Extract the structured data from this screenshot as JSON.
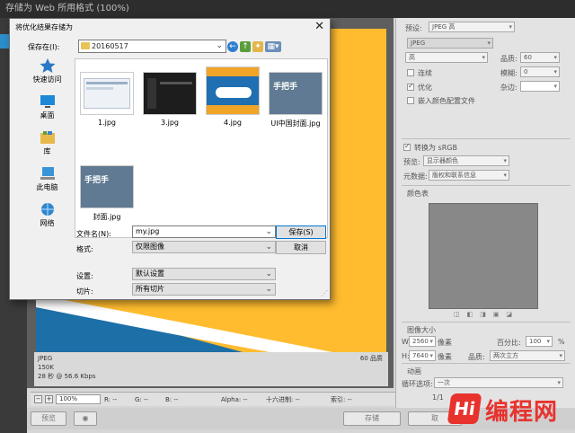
{
  "ps": {
    "title": "存储为 Web 所用格式 (100%)",
    "canvas_info": {
      "format": "JPEG",
      "size": "150K",
      "time": "28 秒 @ 56.6 Kbps",
      "quality": "60 品质"
    },
    "statusbar": {
      "zoom": "100%",
      "r": "R: --",
      "g": "G: --",
      "b": "B: --",
      "alpha": "Alpha: --",
      "hex": "十六进制: --",
      "index": "索引: --"
    },
    "bottom": {
      "preview": "预览",
      "save": "存储",
      "cancel": "取"
    },
    "panel": {
      "preset_label": "预设:",
      "preset_value": "JPEG 高",
      "format_value": "JPEG",
      "quality_level": "高",
      "quality_label": "品质:",
      "quality_value": "60",
      "progressive": "连续",
      "blur_label": "模糊:",
      "blur_value": "0",
      "optimized": "优化",
      "matte_label": "杂边:",
      "embed_profile": "嵌入颜色配置文件",
      "convert_srgb": "转换为 sRGB",
      "preview_label": "预览:",
      "preview_value": "显示器颜色",
      "metadata_label": "元数据:",
      "metadata_value": "版权和联系信息",
      "color_table": "颜色表",
      "image_size": "图像大小",
      "w_label": "W:",
      "w_value": "2560",
      "h_label": "H:",
      "h_value": "7640",
      "unit": "像素",
      "percent_label": "百分比:",
      "percent_value": "100",
      "percent_unit": "%",
      "quality2_label": "品质:",
      "quality2_value": "两次立方",
      "animation": "动画",
      "loop_label": "循环选项:",
      "loop_value": "一次",
      "frame": "1/1"
    }
  },
  "dialog": {
    "title": "将优化结果存储为",
    "save_in_label": "保存在(I):",
    "folder": "20160517",
    "places": [
      "快速访问",
      "桌面",
      "库",
      "此电脑",
      "网络"
    ],
    "files": [
      "1.jpg",
      "3.jpg",
      "4.jpg",
      "UI中国封面.jpg",
      "封面.jpg"
    ],
    "thumb_text": "手把手",
    "filename_label": "文件名(N):",
    "filename_value": "my.jpg",
    "format_label": "格式:",
    "format_value": "仅限图像",
    "settings_label": "设置:",
    "settings_value": "默认设置",
    "slices_label": "切片:",
    "slices_value": "所有切片",
    "save_button": "保存(S)",
    "cancel_button": "取消"
  },
  "watermark": {
    "logo": "Hi",
    "text": "编程网"
  },
  "colors": {
    "canvas_yellow": "#ffbc2f",
    "accent_blue": "#0078d7",
    "watermark_red": "#e8322d"
  }
}
